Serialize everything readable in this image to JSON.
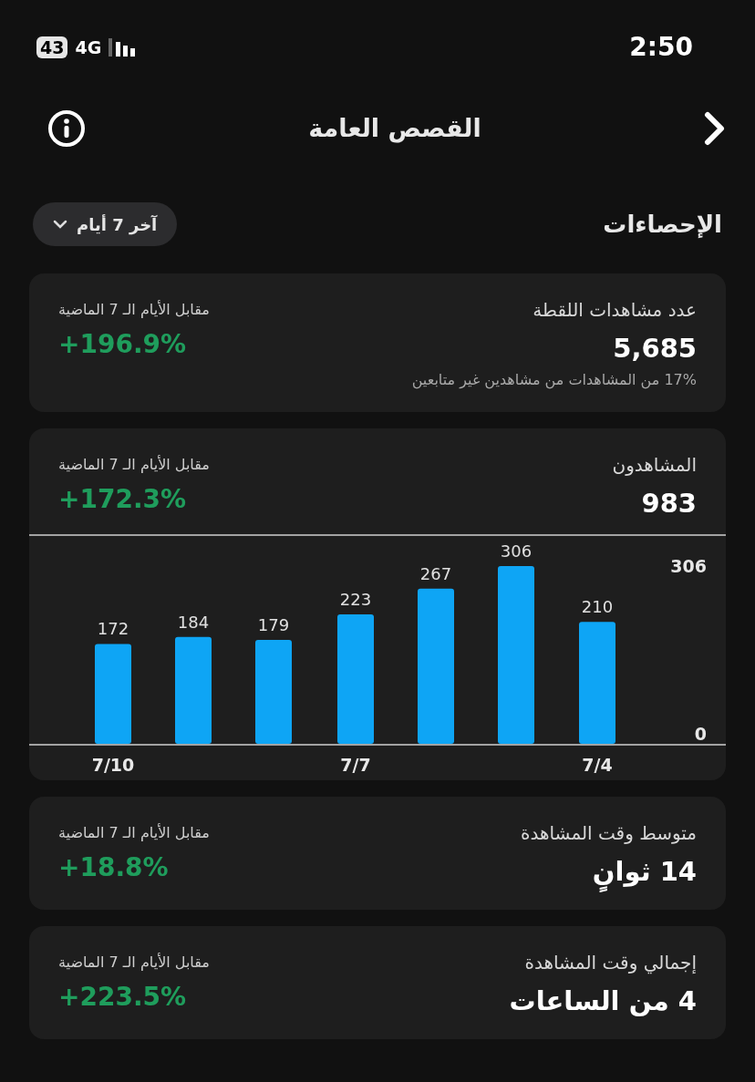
{
  "status_bar": {
    "battery": "43",
    "network": "4G",
    "time": "2:50"
  },
  "header": {
    "title": "القصص العامة"
  },
  "section": {
    "title": "الإحصاءات",
    "range_button": "آخر 7 أيام"
  },
  "cards": [
    {
      "label": "عدد مشاهدات اللقطة",
      "value": "5,685",
      "note": "17% من المشاهدات من مشاهدين غير متابعين",
      "compare_label": "مقابل الأيام الـ 7 الماضية",
      "change": "+196.9%"
    },
    {
      "label": "المشاهدون",
      "value": "983",
      "compare_label": "مقابل الأيام الـ 7 الماضية",
      "change": "+172.3%",
      "chart_data": {
        "type": "bar",
        "categories": [
          "7/10",
          null,
          null,
          "7/7",
          null,
          null,
          "7/4"
        ],
        "ylim": [
          0,
          306
        ],
        "yticks": [
          0,
          306
        ],
        "data_labels": true,
        "series": [
          {
            "color": "#0ea5f5",
            "values": [
              172,
              184,
              179,
              223,
              267,
              306,
              210
            ]
          }
        ]
      }
    },
    {
      "label": "متوسط وقت المشاهدة",
      "value": "14 ثوانٍ",
      "compare_label": "مقابل الأيام الـ 7 الماضية",
      "change": "+18.8%"
    },
    {
      "label": "إجمالي وقت المشاهدة",
      "value": "4 من الساعات",
      "compare_label": "مقابل الأيام الـ 7 الماضية",
      "change": "+223.5%"
    }
  ]
}
